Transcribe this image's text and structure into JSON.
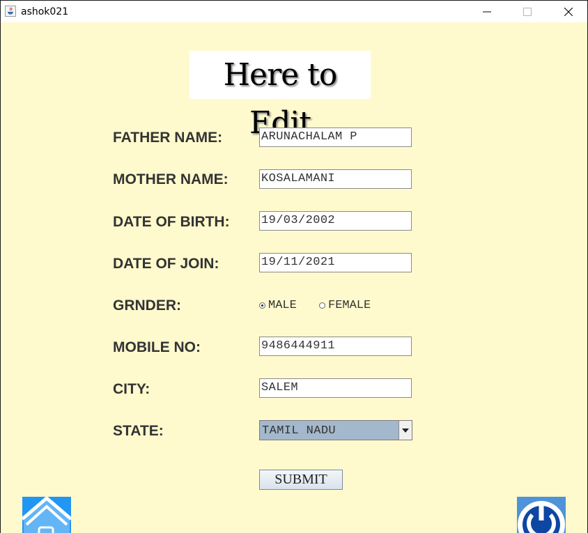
{
  "window": {
    "title": "ashok021"
  },
  "heading": "Here to Edit",
  "form": {
    "father_name": {
      "label": "FATHER NAME:",
      "value": "ARUNACHALAM P"
    },
    "mother_name": {
      "label": "MOTHER NAME:",
      "value": "KOSALAMANI"
    },
    "date_of_birth": {
      "label": "DATE OF BIRTH:",
      "value": "19/03/2002"
    },
    "date_of_join": {
      "label": "DATE OF JOIN:",
      "value": "19/11/2021"
    },
    "gender": {
      "label": "GRNDER:",
      "options": [
        "MALE",
        "FEMALE"
      ],
      "selected": "MALE"
    },
    "mobile_no": {
      "label": "MOBILE NO:",
      "value": "9486444911"
    },
    "city": {
      "label": "CITY:",
      "value": "SALEM"
    },
    "state": {
      "label": "STATE:",
      "selected": "TAMIL NADU"
    },
    "submit_label": "SUBMIT"
  },
  "icons": {
    "home": "home-icon",
    "power": "power-icon",
    "app": "java-icon"
  },
  "colors": {
    "background": "#fffacd",
    "select_background": "#a3b8cc",
    "icon_blue": "#1e88e5"
  }
}
